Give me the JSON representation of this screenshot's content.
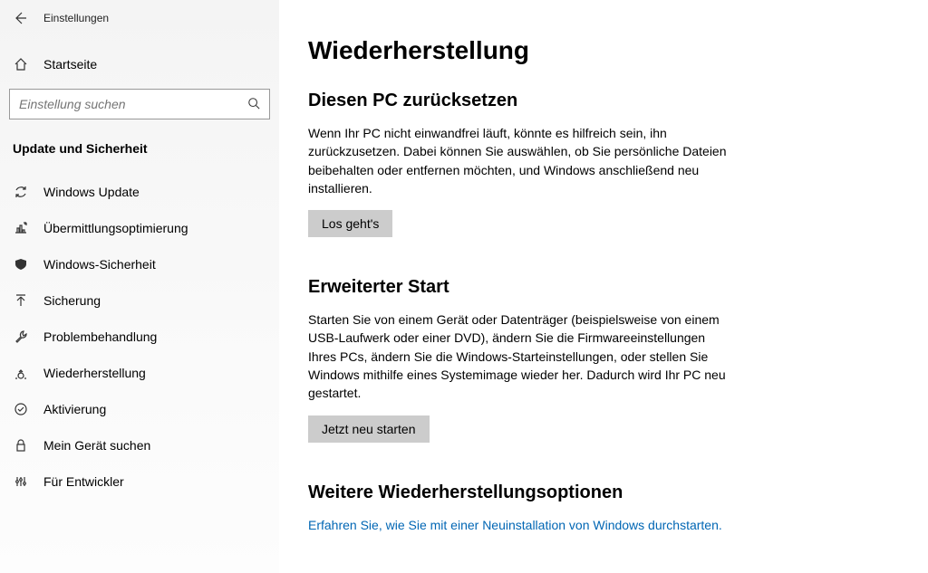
{
  "titlebar": {
    "title": "Einstellungen"
  },
  "home": {
    "label": "Startseite"
  },
  "search": {
    "placeholder": "Einstellung suchen"
  },
  "category": {
    "title": "Update und Sicherheit"
  },
  "nav": {
    "items": [
      {
        "label": "Windows Update"
      },
      {
        "label": "Übermittlungsoptimierung"
      },
      {
        "label": "Windows-Sicherheit"
      },
      {
        "label": "Sicherung"
      },
      {
        "label": "Problembehandlung"
      },
      {
        "label": "Wiederherstellung"
      },
      {
        "label": "Aktivierung"
      },
      {
        "label": "Mein Gerät suchen"
      },
      {
        "label": "Für Entwickler"
      }
    ]
  },
  "main": {
    "title": "Wiederherstellung",
    "sections": [
      {
        "title": "Diesen PC zurücksetzen",
        "desc": "Wenn Ihr PC nicht einwandfrei läuft, könnte es hilfreich sein, ihn zurückzusetzen. Dabei können Sie auswählen, ob Sie persönliche Dateien beibehalten oder entfernen möchten, und Windows anschließend neu installieren.",
        "button": "Los geht's"
      },
      {
        "title": "Erweiterter Start",
        "desc": "Starten Sie von einem Gerät oder Datenträger (beispielsweise von einem USB-Laufwerk oder einer DVD), ändern Sie die Firmwareeinstellungen Ihres PCs, ändern Sie die Windows-Starteinstellungen, oder stellen Sie Windows mithilfe eines Systemimage wieder her. Dadurch wird Ihr PC neu gestartet.",
        "button": "Jetzt neu starten"
      },
      {
        "title": "Weitere Wiederherstellungsoptionen",
        "link": "Erfahren Sie, wie Sie mit einer Neuinstallation von Windows durchstarten."
      }
    ]
  }
}
